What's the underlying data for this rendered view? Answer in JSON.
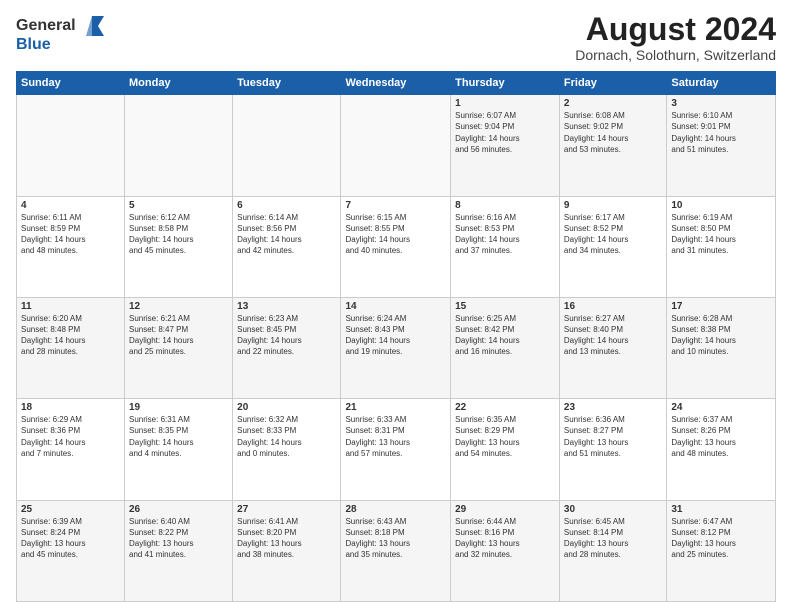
{
  "header": {
    "logo_general": "General",
    "logo_blue": "Blue",
    "month_year": "August 2024",
    "location": "Dornach, Solothurn, Switzerland"
  },
  "days_of_week": [
    "Sunday",
    "Monday",
    "Tuesday",
    "Wednesday",
    "Thursday",
    "Friday",
    "Saturday"
  ],
  "weeks": [
    [
      {
        "day": "",
        "info": ""
      },
      {
        "day": "",
        "info": ""
      },
      {
        "day": "",
        "info": ""
      },
      {
        "day": "",
        "info": ""
      },
      {
        "day": "1",
        "info": "Sunrise: 6:07 AM\nSunset: 9:04 PM\nDaylight: 14 hours\nand 56 minutes."
      },
      {
        "day": "2",
        "info": "Sunrise: 6:08 AM\nSunset: 9:02 PM\nDaylight: 14 hours\nand 53 minutes."
      },
      {
        "day": "3",
        "info": "Sunrise: 6:10 AM\nSunset: 9:01 PM\nDaylight: 14 hours\nand 51 minutes."
      }
    ],
    [
      {
        "day": "4",
        "info": "Sunrise: 6:11 AM\nSunset: 8:59 PM\nDaylight: 14 hours\nand 48 minutes."
      },
      {
        "day": "5",
        "info": "Sunrise: 6:12 AM\nSunset: 8:58 PM\nDaylight: 14 hours\nand 45 minutes."
      },
      {
        "day": "6",
        "info": "Sunrise: 6:14 AM\nSunset: 8:56 PM\nDaylight: 14 hours\nand 42 minutes."
      },
      {
        "day": "7",
        "info": "Sunrise: 6:15 AM\nSunset: 8:55 PM\nDaylight: 14 hours\nand 40 minutes."
      },
      {
        "day": "8",
        "info": "Sunrise: 6:16 AM\nSunset: 8:53 PM\nDaylight: 14 hours\nand 37 minutes."
      },
      {
        "day": "9",
        "info": "Sunrise: 6:17 AM\nSunset: 8:52 PM\nDaylight: 14 hours\nand 34 minutes."
      },
      {
        "day": "10",
        "info": "Sunrise: 6:19 AM\nSunset: 8:50 PM\nDaylight: 14 hours\nand 31 minutes."
      }
    ],
    [
      {
        "day": "11",
        "info": "Sunrise: 6:20 AM\nSunset: 8:48 PM\nDaylight: 14 hours\nand 28 minutes."
      },
      {
        "day": "12",
        "info": "Sunrise: 6:21 AM\nSunset: 8:47 PM\nDaylight: 14 hours\nand 25 minutes."
      },
      {
        "day": "13",
        "info": "Sunrise: 6:23 AM\nSunset: 8:45 PM\nDaylight: 14 hours\nand 22 minutes."
      },
      {
        "day": "14",
        "info": "Sunrise: 6:24 AM\nSunset: 8:43 PM\nDaylight: 14 hours\nand 19 minutes."
      },
      {
        "day": "15",
        "info": "Sunrise: 6:25 AM\nSunset: 8:42 PM\nDaylight: 14 hours\nand 16 minutes."
      },
      {
        "day": "16",
        "info": "Sunrise: 6:27 AM\nSunset: 8:40 PM\nDaylight: 14 hours\nand 13 minutes."
      },
      {
        "day": "17",
        "info": "Sunrise: 6:28 AM\nSunset: 8:38 PM\nDaylight: 14 hours\nand 10 minutes."
      }
    ],
    [
      {
        "day": "18",
        "info": "Sunrise: 6:29 AM\nSunset: 8:36 PM\nDaylight: 14 hours\nand 7 minutes."
      },
      {
        "day": "19",
        "info": "Sunrise: 6:31 AM\nSunset: 8:35 PM\nDaylight: 14 hours\nand 4 minutes."
      },
      {
        "day": "20",
        "info": "Sunrise: 6:32 AM\nSunset: 8:33 PM\nDaylight: 14 hours\nand 0 minutes."
      },
      {
        "day": "21",
        "info": "Sunrise: 6:33 AM\nSunset: 8:31 PM\nDaylight: 13 hours\nand 57 minutes."
      },
      {
        "day": "22",
        "info": "Sunrise: 6:35 AM\nSunset: 8:29 PM\nDaylight: 13 hours\nand 54 minutes."
      },
      {
        "day": "23",
        "info": "Sunrise: 6:36 AM\nSunset: 8:27 PM\nDaylight: 13 hours\nand 51 minutes."
      },
      {
        "day": "24",
        "info": "Sunrise: 6:37 AM\nSunset: 8:26 PM\nDaylight: 13 hours\nand 48 minutes."
      }
    ],
    [
      {
        "day": "25",
        "info": "Sunrise: 6:39 AM\nSunset: 8:24 PM\nDaylight: 13 hours\nand 45 minutes."
      },
      {
        "day": "26",
        "info": "Sunrise: 6:40 AM\nSunset: 8:22 PM\nDaylight: 13 hours\nand 41 minutes."
      },
      {
        "day": "27",
        "info": "Sunrise: 6:41 AM\nSunset: 8:20 PM\nDaylight: 13 hours\nand 38 minutes."
      },
      {
        "day": "28",
        "info": "Sunrise: 6:43 AM\nSunset: 8:18 PM\nDaylight: 13 hours\nand 35 minutes."
      },
      {
        "day": "29",
        "info": "Sunrise: 6:44 AM\nSunset: 8:16 PM\nDaylight: 13 hours\nand 32 minutes."
      },
      {
        "day": "30",
        "info": "Sunrise: 6:45 AM\nSunset: 8:14 PM\nDaylight: 13 hours\nand 28 minutes."
      },
      {
        "day": "31",
        "info": "Sunrise: 6:47 AM\nSunset: 8:12 PM\nDaylight: 13 hours\nand 25 minutes."
      }
    ]
  ]
}
